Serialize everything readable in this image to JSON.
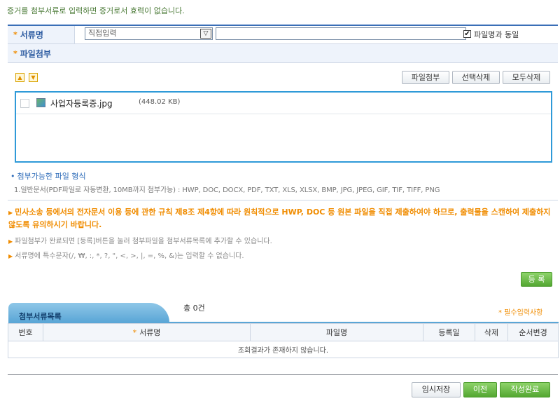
{
  "notice_top": "증거를 첨부서류로 입력하면 증거로서 효력이 없습니다.",
  "form": {
    "doc_name_label": "서류명",
    "select_value": "직접입력",
    "select_arrow": "▽",
    "doc_name_value": "",
    "same_as_filename_label": "파일명과 동일",
    "same_as_filename_checked": true,
    "check_mark": "✔",
    "attach_label": "파일첨부",
    "required_mark": "*"
  },
  "toolbar": {
    "move_up": "▲",
    "move_down": "▼",
    "attach_button": "파일첨부",
    "delete_selected_button": "선택삭제",
    "delete_all_button": "모두삭제"
  },
  "files": [
    {
      "name": "사업자등록증.jpg",
      "size": "(448.02 KB)",
      "checked": false
    }
  ],
  "formats": {
    "title": "첨부가능한 파일 형식",
    "bullet": "•",
    "text": "1.일반문서(PDF파일로 자동변환, 10MB까지 첨부가능) : HWP, DOC, DOCX, PDF, TXT, XLS, XLSX, BMP, JPG, JPEG, GIF, TIF, TIFF, PNG"
  },
  "notes": {
    "marker": "▶",
    "warning": "민사소송 등에서의 전자문서 이용 등에 관한 규칙 제8조 제4항에 따라 원칙적으로 HWP, DOC 등 원본 파일을 직접 제출하여야 하므로, 출력물을 스캔하여 제출하지 않도록 유의하시기 바랍니다.",
    "note1": "파일첨부가 완료되면 [등록]버튼을 눌러 첨부파일을 첨부서류목록에 추가할 수 있습니다.",
    "note2": "서류명에 특수문자(/, ₩, :, *, ?, \", <, >, |, =, %, &)는 입력할 수 없습니다."
  },
  "register_button": "등 록",
  "list": {
    "tab_label": "첨부서류목록",
    "total": "총 0건",
    "required_note": "* 필수입력사항",
    "columns": [
      "번호",
      "서류명",
      "파일명",
      "등록일",
      "삭제",
      "순서변경"
    ],
    "empty_message": "조회결과가 존재하지 않습니다."
  },
  "footer": {
    "temp_save": "임시저장",
    "prev": "이전",
    "complete": "작성완료"
  },
  "colors": {
    "accent_blue": "#3a6fb7",
    "warning_orange": "#f08c00",
    "button_green": "#53a731",
    "file_box_border": "#2f9ad8"
  }
}
